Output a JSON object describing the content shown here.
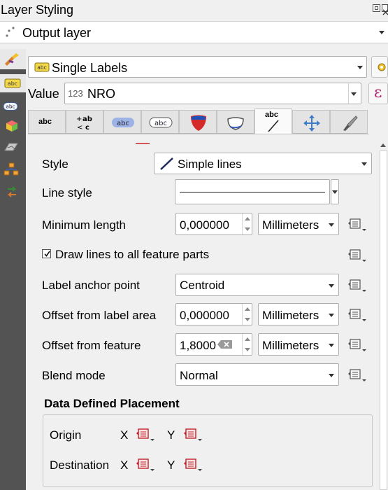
{
  "window": {
    "title": "Layer Styling"
  },
  "layer_selector": {
    "value": "Output layer"
  },
  "labels_mode": {
    "value": "Single Labels"
  },
  "value_field": {
    "label": "Value",
    "type_badge": "123",
    "value": "NRO",
    "expr_icon": "ε"
  },
  "tabs": [
    {
      "name": "text",
      "text": "abc"
    },
    {
      "name": "formatting",
      "text": "+ab <c"
    },
    {
      "name": "buffer",
      "text": "abc"
    },
    {
      "name": "background",
      "text": "abc"
    },
    {
      "name": "shadow",
      "text": ""
    },
    {
      "name": "callouts",
      "text": ""
    },
    {
      "name": "placement",
      "text": "abc"
    },
    {
      "name": "placement-move",
      "text": ""
    },
    {
      "name": "rendering",
      "text": ""
    }
  ],
  "active_tab": "callouts",
  "form": {
    "style": {
      "label": "Style",
      "value": "Simple lines"
    },
    "line_style": {
      "label": "Line style"
    },
    "min_length": {
      "label": "Minimum length",
      "value": "0,000000",
      "unit": "Millimeters"
    },
    "draw_all": {
      "label": "Draw lines to all feature parts",
      "checked": true
    },
    "anchor": {
      "label": "Label anchor point",
      "value": "Centroid"
    },
    "offset_label_area": {
      "label": "Offset from label area",
      "value": "0,000000",
      "unit": "Millimeters"
    },
    "offset_feature": {
      "label": "Offset from feature",
      "value": "1,8000",
      "unit": "Millimeters"
    },
    "blend": {
      "label": "Blend mode",
      "value": "Normal"
    },
    "data_defined": {
      "title": "Data Defined Placement",
      "origin": {
        "label": "Origin",
        "x": "X",
        "y": "Y"
      },
      "destination": {
        "label": "Destination",
        "x": "X",
        "y": "Y"
      }
    }
  },
  "colors": {
    "sidebar": "#535353",
    "accent_red": "#c0232b",
    "tab_active": "#fafafa"
  }
}
